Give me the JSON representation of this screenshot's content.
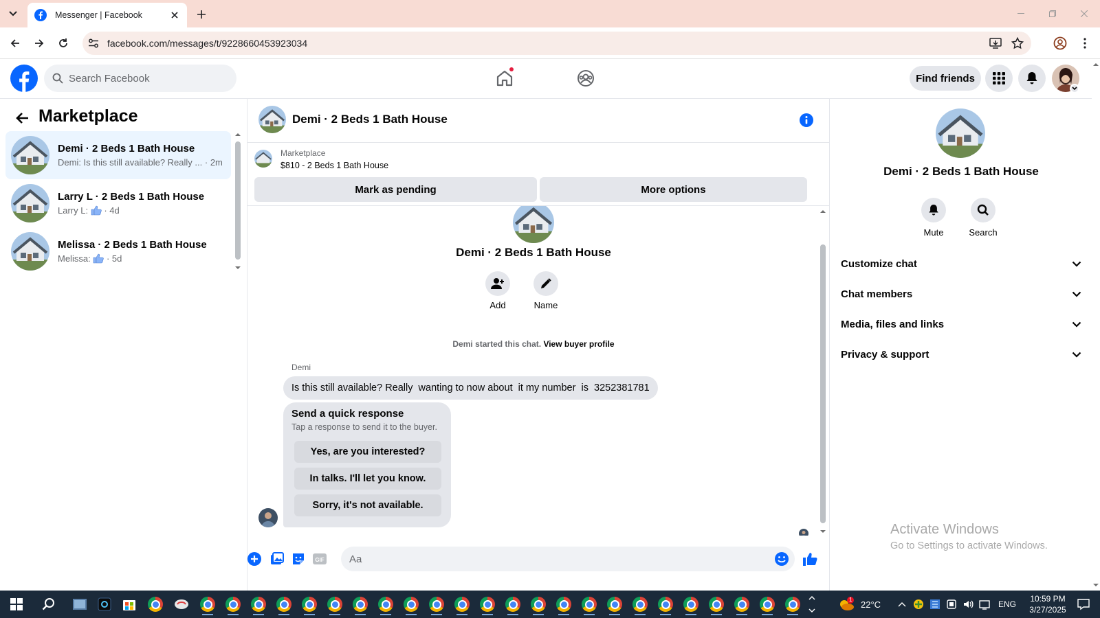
{
  "browser": {
    "tab_title": "Messenger | Facebook",
    "url": "facebook.com/messages/t/9228660453923034"
  },
  "header": {
    "search_placeholder": "Search Facebook",
    "find_friends": "Find friends",
    "brand_color": "#0866ff"
  },
  "left": {
    "title": "Marketplace",
    "conversations": [
      {
        "name": "Demi · 2 Beds 1 Bath House",
        "preview": "Demi: Is this still available? Really ...",
        "time": "· 2m"
      },
      {
        "name": "Larry L · 2 Beds 1 Bath House",
        "preview": "Larry L:",
        "time": "· 4d"
      },
      {
        "name": "Melissa · 2 Beds 1 Bath House",
        "preview": "Melissa:",
        "time": "· 5d"
      }
    ]
  },
  "chat": {
    "title": "Demi · 2 Beds 1 Bath House",
    "listing_source": "Marketplace",
    "listing_item": "$810 - 2 Beds 1 Bath House",
    "mark_pending": "Mark as pending",
    "more_options": "More options",
    "add_label": "Add",
    "name_label": "Name",
    "started_text": "Demi started this chat.",
    "view_profile": "View buyer profile",
    "sender": "Demi",
    "message": "Is this still available? Really  wanting to now about  it my number  is  3252381781",
    "quick_title": "Send a quick response",
    "quick_sub": "Tap a response to send it to the buyer.",
    "quick_options": [
      "Yes, are you interested?",
      "In talks. I'll let you know.",
      "Sorry, it's not available."
    ],
    "composer_placeholder": "Aa"
  },
  "details": {
    "name": "Demi · 2 Beds 1 Bath House",
    "mute": "Mute",
    "search": "Search",
    "sections": [
      "Customize chat",
      "Chat members",
      "Media, files and links",
      "Privacy & support"
    ]
  },
  "watermark": {
    "line1": "Activate Windows",
    "line2": "Go to Settings to activate Windows."
  },
  "taskbar": {
    "temperature": "22°C",
    "weather_badge": "1",
    "language": "ENG",
    "time": "10:59 PM",
    "date": "3/27/2025"
  }
}
